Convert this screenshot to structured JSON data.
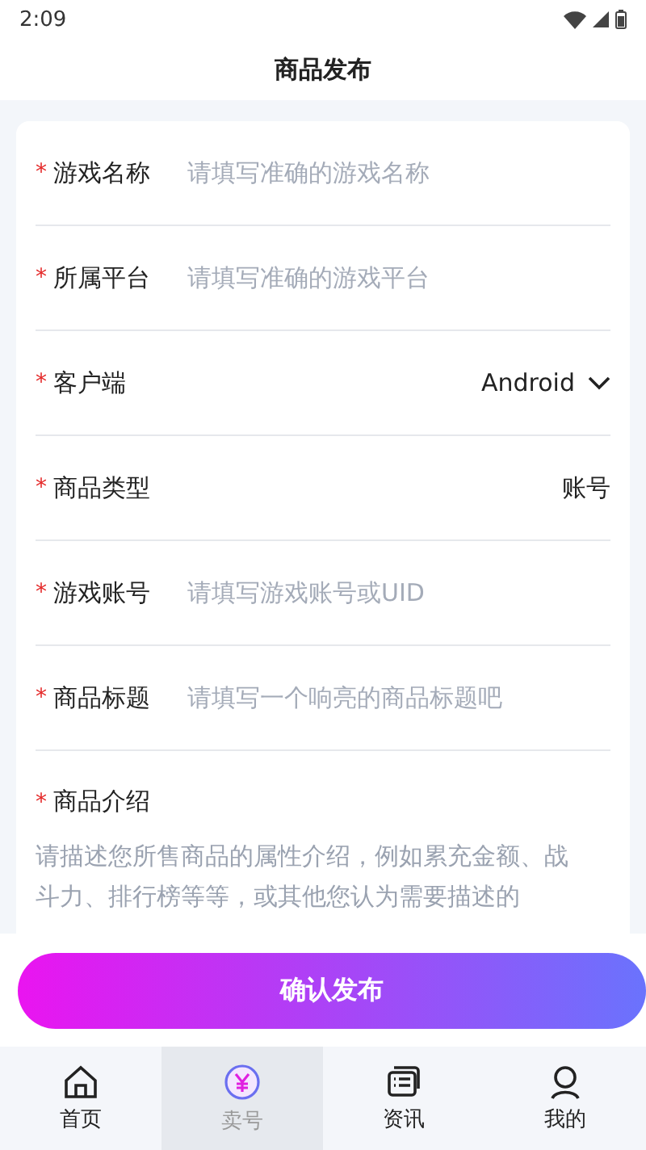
{
  "status_bar": {
    "time": "2:09"
  },
  "title": "商品发布",
  "fields": [
    {
      "kind": "input",
      "mark": "*",
      "label": "游戏名称",
      "placeholder": "请填写准确的游戏名称"
    },
    {
      "kind": "input",
      "mark": "*",
      "label": "所属平台",
      "placeholder": "请填写准确的游戏平台"
    },
    {
      "kind": "select",
      "mark": "*",
      "label": "客户端",
      "value": "Android"
    },
    {
      "kind": "value",
      "mark": "*",
      "label": "商品类型",
      "value": "账号"
    },
    {
      "kind": "input",
      "mark": "*",
      "label": "游戏账号",
      "placeholder": "请填写游戏账号或UID"
    },
    {
      "kind": "input",
      "mark": "*",
      "label": "商品标题",
      "placeholder": "请填写一个响亮的商品标题吧"
    }
  ],
  "description": {
    "mark": "*",
    "label": "商品介绍",
    "placeholder": "请描述您所售商品的属性介绍，例如累充金额、战斗力、排行榜等等，或其他您认为需要描述的"
  },
  "submit": "确认发布",
  "nav": [
    {
      "kind": "home",
      "label": "首页",
      "selected": false
    },
    {
      "kind": "sell",
      "label": "卖号",
      "selected": true
    },
    {
      "kind": "news",
      "label": "资讯",
      "selected": false
    },
    {
      "kind": "me",
      "label": "我的",
      "selected": false
    }
  ]
}
